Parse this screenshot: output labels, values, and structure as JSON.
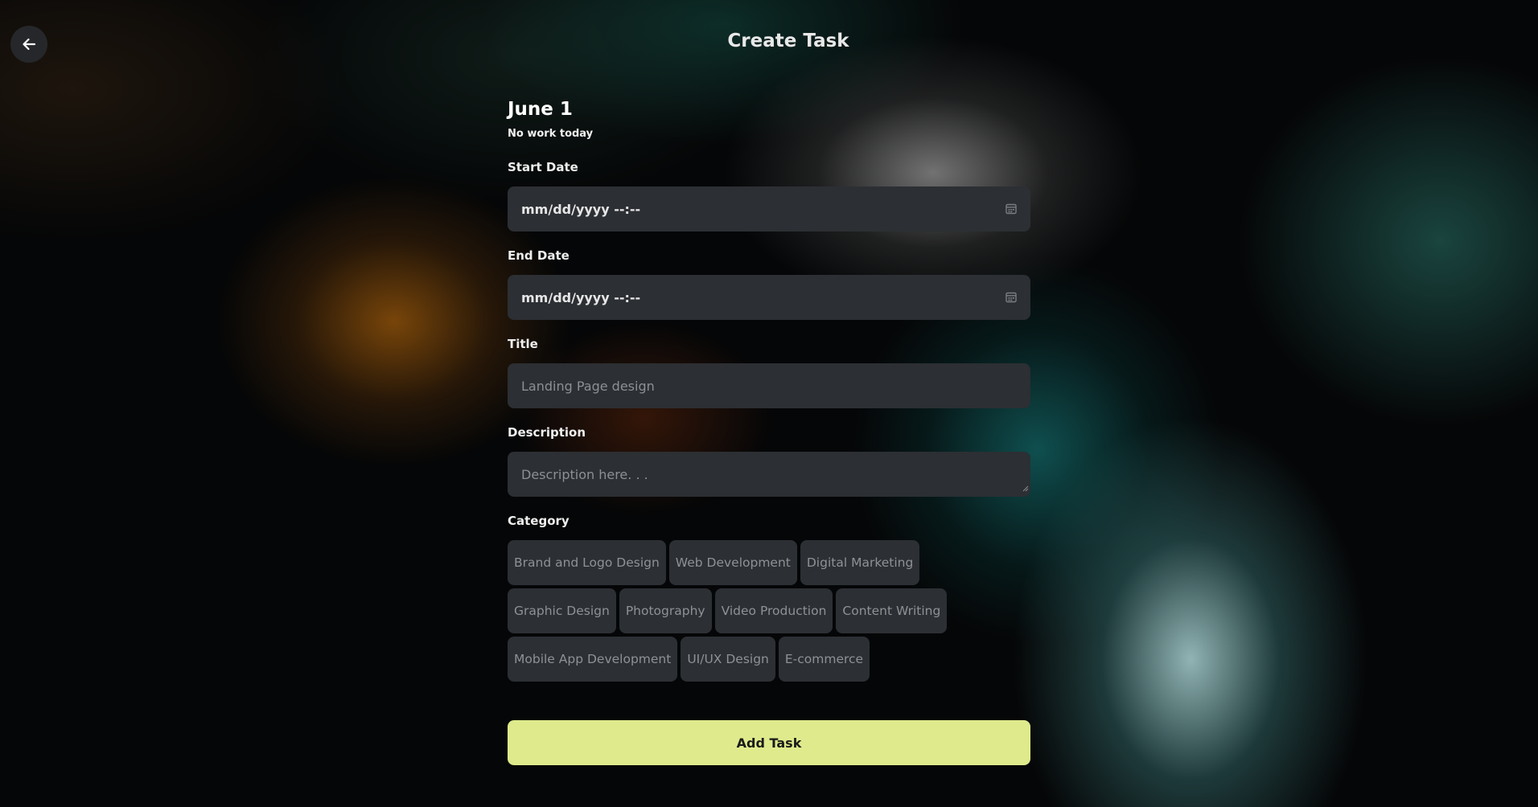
{
  "header": {
    "title": "Create Task"
  },
  "summary": {
    "date": "June 1",
    "status": "No work today"
  },
  "form": {
    "start_date": {
      "label": "Start Date",
      "value": "mm/dd/yyyy --:--"
    },
    "end_date": {
      "label": "End Date",
      "value": "mm/dd/yyyy --:--"
    },
    "title": {
      "label": "Title",
      "placeholder": "Landing Page design"
    },
    "description": {
      "label": "Description",
      "placeholder": "Description here. . ."
    },
    "category": {
      "label": "Category",
      "options": [
        "Brand and Logo Design",
        "Web Development",
        "Digital Marketing",
        "Graphic Design",
        "Photography",
        "Video Production",
        "Content Writing",
        "Mobile App Development",
        "UI/UX Design",
        "E-commerce"
      ]
    },
    "submit_label": "Add Task"
  },
  "icons": {
    "back": "arrow-left-icon",
    "calendar": "calendar-icon"
  },
  "colors": {
    "accent": "#dfea8c",
    "field_bg": "#2c2f33"
  }
}
